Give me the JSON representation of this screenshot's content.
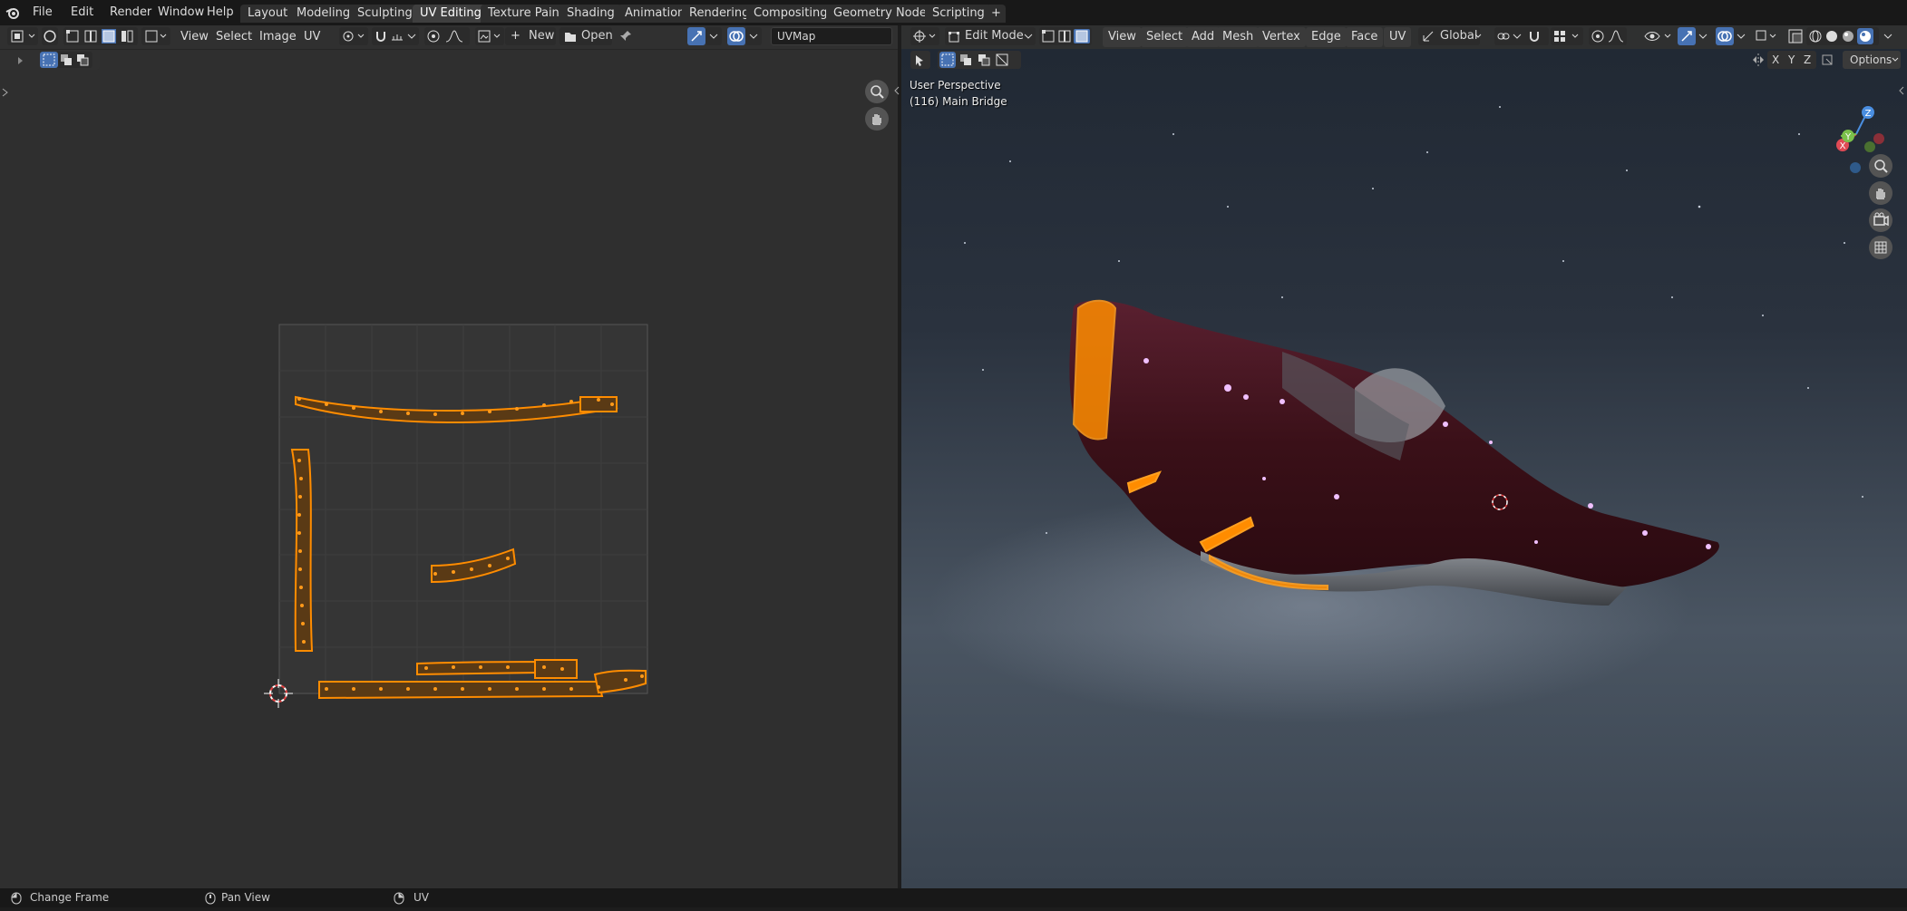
{
  "topbar": {
    "menus": [
      "File",
      "Edit",
      "Render",
      "Window",
      "Help"
    ],
    "workspaces": [
      "Layout",
      "Modeling",
      "Sculpting",
      "UV Editing",
      "Texture Paint",
      "Shading",
      "Animation",
      "Rendering",
      "Compositing",
      "Geometry Nodes",
      "Scripting"
    ],
    "active_workspace": "UV Editing",
    "add_tab": "+"
  },
  "uv_editor": {
    "menus": [
      "View",
      "Select",
      "Image",
      "UV"
    ],
    "new_label": "New",
    "open_label": "Open",
    "uvmap_field": "UVMap"
  },
  "viewport": {
    "mode": "Edit Mode",
    "menus": [
      "View",
      "Select",
      "Add",
      "Mesh",
      "Vertex",
      "Edge",
      "Face",
      "UV"
    ],
    "orientation": "Global",
    "overlay_title": "User Perspective",
    "overlay_object": "(116) Main Bridge",
    "axis_x": "X",
    "axis_y": "Y",
    "axis_z": "Z",
    "options_label": "Options",
    "gizmo_labels": {
      "x": "X",
      "y": "Y",
      "z": "Z"
    }
  },
  "statusbar": {
    "items": [
      "Change Frame",
      "Pan View",
      "UV"
    ]
  },
  "colors": {
    "accent": "#4772b3",
    "uv_orange": "#ff8c00",
    "hull": "#4a1a22"
  }
}
